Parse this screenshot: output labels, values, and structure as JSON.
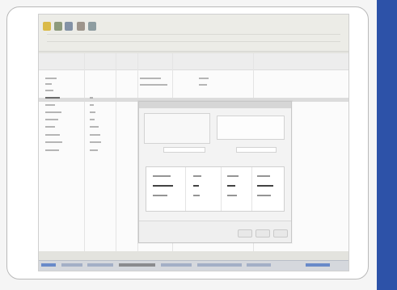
{
  "colors": {
    "accent_band": "#2d52a8",
    "card_border": "#b9b9b9",
    "screenshot_bg": "#e3e3de",
    "modal_bg": "#f3f3f3"
  },
  "icons": [
    "app-icon",
    "toolbar-icon-1",
    "toolbar-icon-2",
    "toolbar-icon-3",
    "toolbar-icon-4"
  ]
}
